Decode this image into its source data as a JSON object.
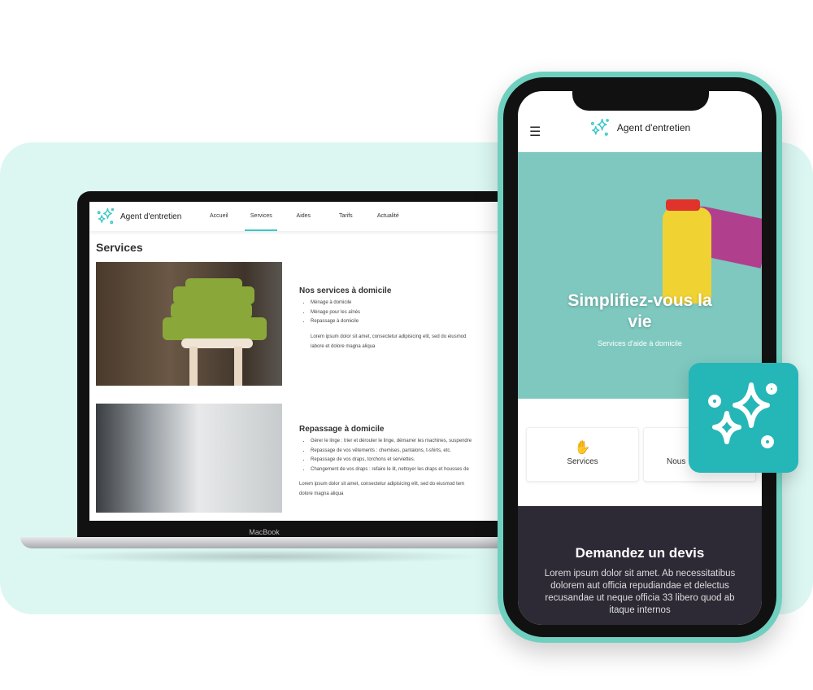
{
  "laptop": {
    "brand": "Agent d'entretien",
    "nav": [
      "Accueil",
      "Services",
      "Aides",
      "Tarifs",
      "Actualité"
    ],
    "active_tab": "Services",
    "page_title": "Services",
    "sections": [
      {
        "title": "Nos services à domicile",
        "items": [
          "Ménage à domicile",
          "Ménage pour les aînés",
          "Repassage à domicile"
        ],
        "text_lines": [
          "Lorem ipsum dolor sit amet, consectetur adipisicing elit, sed do eiusmod",
          "labore et dolore magna aliqua"
        ]
      },
      {
        "title": "Repassage à domicile",
        "items": [
          "Gérer le linge : trier et dérouler le linge, démarrer les machines, suspendre",
          "Repassage de vos vêtements : chemises, pantalons, t-shirts, etc.",
          "Repassage de vos draps, torchons et serviettes.",
          "Changement de vos draps : refaire le lit, nettoyer les draps et housses de"
        ],
        "text_lines": [
          "Lorem ipsum dolor sit amet, consectetur adipisicing elit, sed do eiusmod tem",
          "dolore magna aliqua"
        ]
      }
    ],
    "device_label": "MacBook"
  },
  "phone": {
    "brand": "Agent d'entretien",
    "menu_icon": "hamburger-icon",
    "hero_title": "Simplifiez-vous la vie",
    "hero_subtitle": "Services d'aide à domicile",
    "cards": [
      "Services",
      "Nous"
    ],
    "cta_title": "Demandez un devis",
    "cta_text": "Lorem ipsum dolor sit amet. Ab necessitatibus dolorem aut officia repudiandae et delectus recusandae ut neque officia 33 libero quod ab itaque internos"
  },
  "colors": {
    "accent": "#25b6b8",
    "mint": "#dcf7f2",
    "phone_frame": "#6fd0bf",
    "dark": "#2d2a36"
  }
}
